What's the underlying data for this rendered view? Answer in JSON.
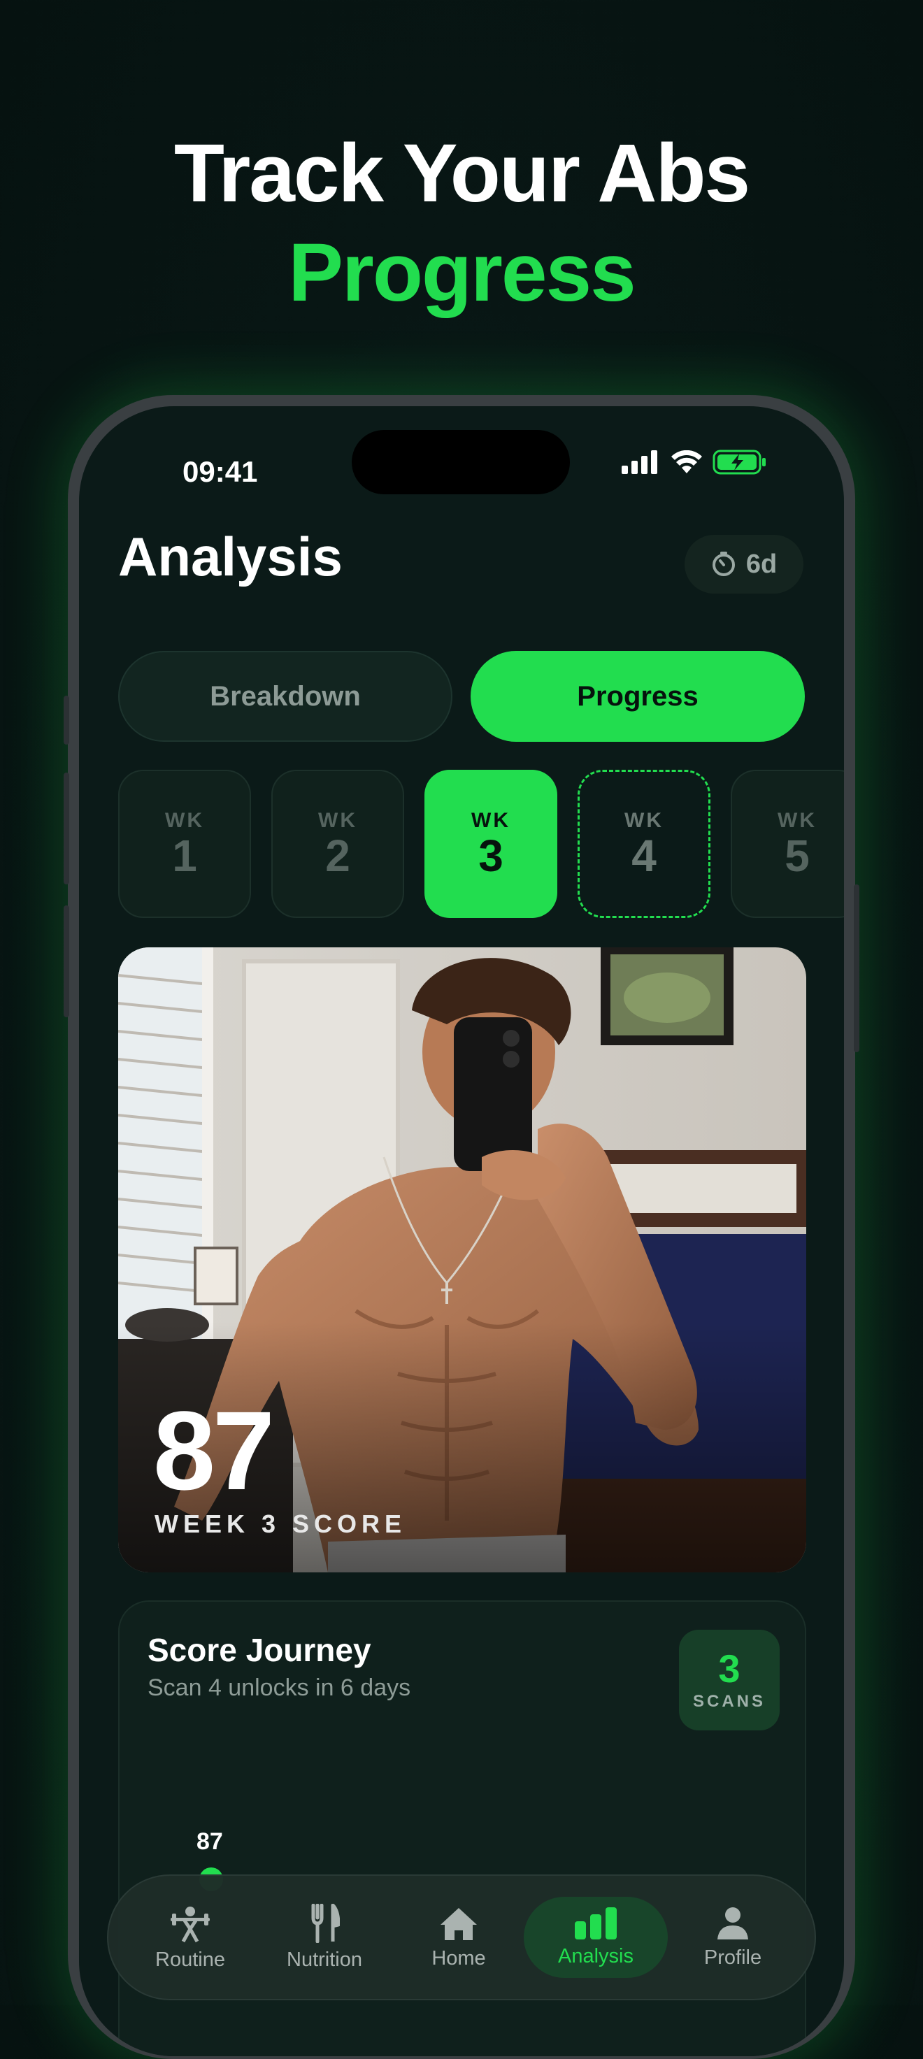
{
  "hero": {
    "line1": "Track Your Abs",
    "line2": "Progress"
  },
  "status_bar": {
    "time": "09:41",
    "icons": [
      "cellular-icon",
      "wifi-icon",
      "battery-charging-icon"
    ]
  },
  "header": {
    "title": "Analysis",
    "timer_icon": "timer-icon",
    "timer_label": "6d"
  },
  "segmented": {
    "options": [
      "Breakdown",
      "Progress"
    ],
    "selected": "Progress"
  },
  "weeks": [
    {
      "label": "WK",
      "number": "1",
      "state": "done"
    },
    {
      "label": "WK",
      "number": "2",
      "state": "done"
    },
    {
      "label": "WK",
      "number": "3",
      "state": "selected"
    },
    {
      "label": "WK",
      "number": "4",
      "state": "upcoming"
    },
    {
      "label": "WK",
      "number": "5",
      "state": "locked"
    }
  ],
  "photo_card": {
    "score": "87",
    "caption": "WEEK 3 SCORE"
  },
  "journey": {
    "title": "Score Journey",
    "subtitle": "Scan 4 unlocks in 6 days",
    "scans_count": "3",
    "scans_label": "SCANS",
    "first_point_label": "87"
  },
  "tabbar": {
    "items": [
      {
        "label": "Routine",
        "icon": "weightlifter-icon"
      },
      {
        "label": "Nutrition",
        "icon": "fork-knife-icon"
      },
      {
        "label": "Home",
        "icon": "home-icon"
      },
      {
        "label": "Analysis",
        "icon": "bar-chart-icon"
      },
      {
        "label": "Profile",
        "icon": "person-icon"
      }
    ],
    "active": "Analysis"
  },
  "colors": {
    "accent": "#22dd4f",
    "background": "#0b1a18"
  }
}
